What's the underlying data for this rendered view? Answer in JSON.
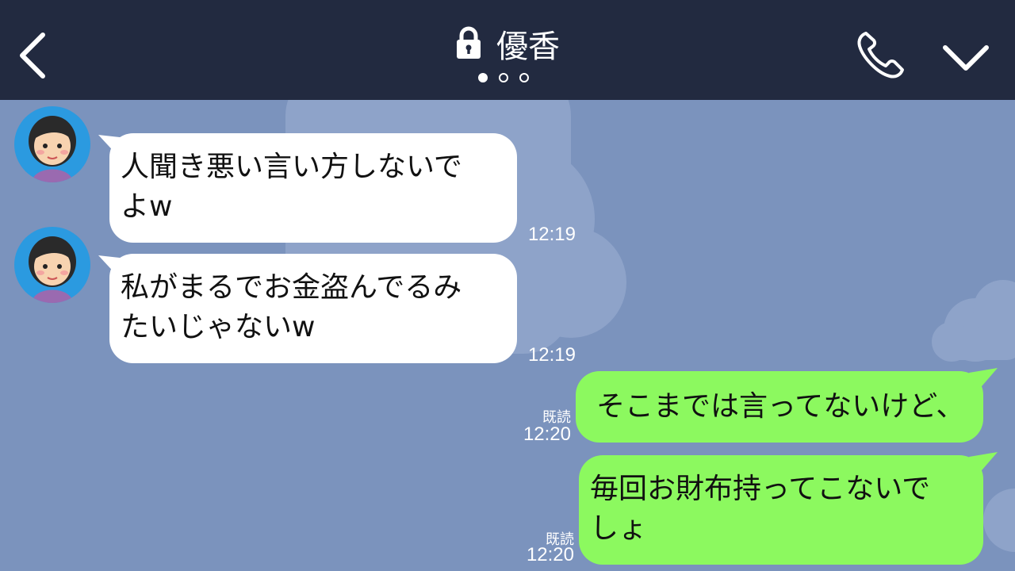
{
  "header": {
    "title": "優香",
    "page_dots": 3,
    "active_dot": 0,
    "back_icon": "chevron-left-icon",
    "lock_icon": "lock-icon",
    "call_icon": "phone-icon",
    "menu_icon": "chevron-down-icon"
  },
  "colors": {
    "header_bg": "#222a40",
    "chat_bg": "#7b93bd",
    "incoming_bubble": "#ffffff",
    "outgoing_bubble": "#8cf95f"
  },
  "messages": [
    {
      "direction": "incoming",
      "text": "人聞き悪い言い方しないで\nよw",
      "time": "12:19"
    },
    {
      "direction": "incoming",
      "text": "私がまるでお金盗んでるみ\nたいじゃないw",
      "time": "12:19"
    },
    {
      "direction": "outgoing",
      "text": "そこまでは言ってないけど、",
      "read": "既読",
      "time": "12:20"
    },
    {
      "direction": "outgoing",
      "text": "毎回お財布持ってこないで\nしょ",
      "read": "既読",
      "time": "12:20"
    }
  ]
}
